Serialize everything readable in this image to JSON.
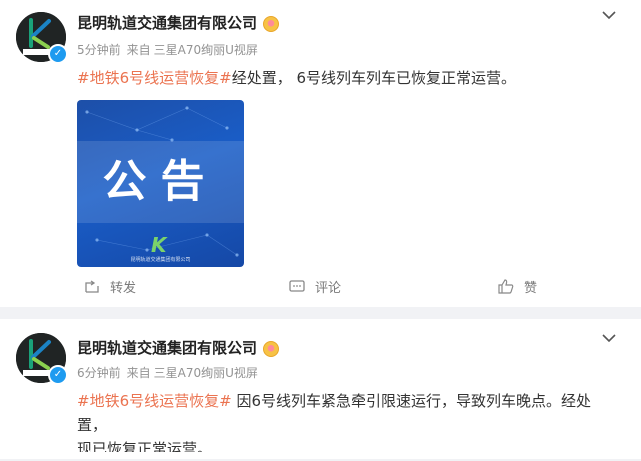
{
  "posts": [
    {
      "author": "昆明轨道交通集团有限公司",
      "time": "5分钟前",
      "source_prefix": "来自",
      "source": "三星A70绚丽U视屏",
      "topic": "#地铁6号线运营恢复#",
      "text": "经处置， 6号线列车列车已恢复正常运营。",
      "image": {
        "headline": "公告",
        "watermark": "昆明轨道交通集团有限公司"
      },
      "actions": {
        "repost": "转发",
        "comment": "评论",
        "like": "赞"
      }
    },
    {
      "author": "昆明轨道交通集团有限公司",
      "time": "6分钟前",
      "source_prefix": "来自",
      "source": "三星A70绚丽U视屏",
      "topic": "#地铁6号线运营恢复#",
      "text_line1": " 因6号线列车紧急牵引限速运行，导致列车晚点。经处置，",
      "text_line2": "现已恢复正常运营。"
    }
  ],
  "icons": {
    "verified": "verified-badge-icon",
    "vip": "vip-badge-icon",
    "more": "chevron-down-icon",
    "repost": "repost-icon",
    "comment": "comment-icon",
    "like": "thumb-up-icon"
  },
  "colors": {
    "topic": "#eb7350",
    "background": "#f1f2f5",
    "card": "#ffffff"
  }
}
